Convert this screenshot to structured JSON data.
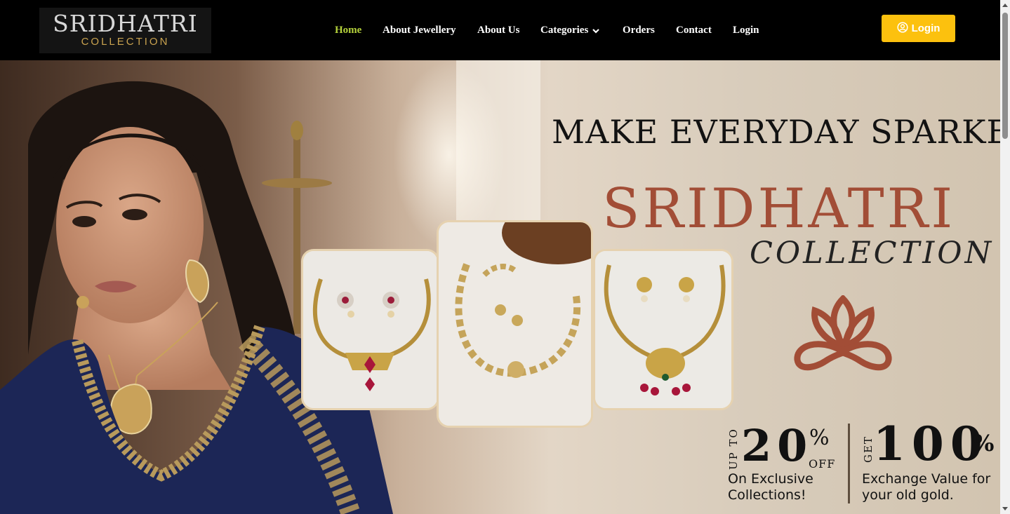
{
  "brand": {
    "logo_main": "SRIDHATRI",
    "logo_sub": "COLLECTION"
  },
  "nav": {
    "items": [
      {
        "label": "Home",
        "active": true
      },
      {
        "label": "About Jewellery"
      },
      {
        "label": "About Us"
      },
      {
        "label": "Categories"
      },
      {
        "label": "Orders"
      },
      {
        "label": "Contact"
      },
      {
        "label": "Login"
      }
    ],
    "login_button": "Login",
    "active_color": "#b6d33c",
    "button_color": "#fcc10e"
  },
  "hero": {
    "tagline": "MAKE EVERYDAY SPARKEL",
    "brand_title": "SRIDHATRI",
    "brand_subtitle": "COLLECTION",
    "brand_color": "#a24d36",
    "offer1": {
      "prefix": "UP TO",
      "value": "20",
      "percent": "%",
      "suffix": "OFF",
      "description": "On Exclusive Collections!"
    },
    "offer2": {
      "prefix": "GET",
      "value": "100",
      "percent": "%",
      "description": "Exchange Value for your old gold."
    }
  }
}
